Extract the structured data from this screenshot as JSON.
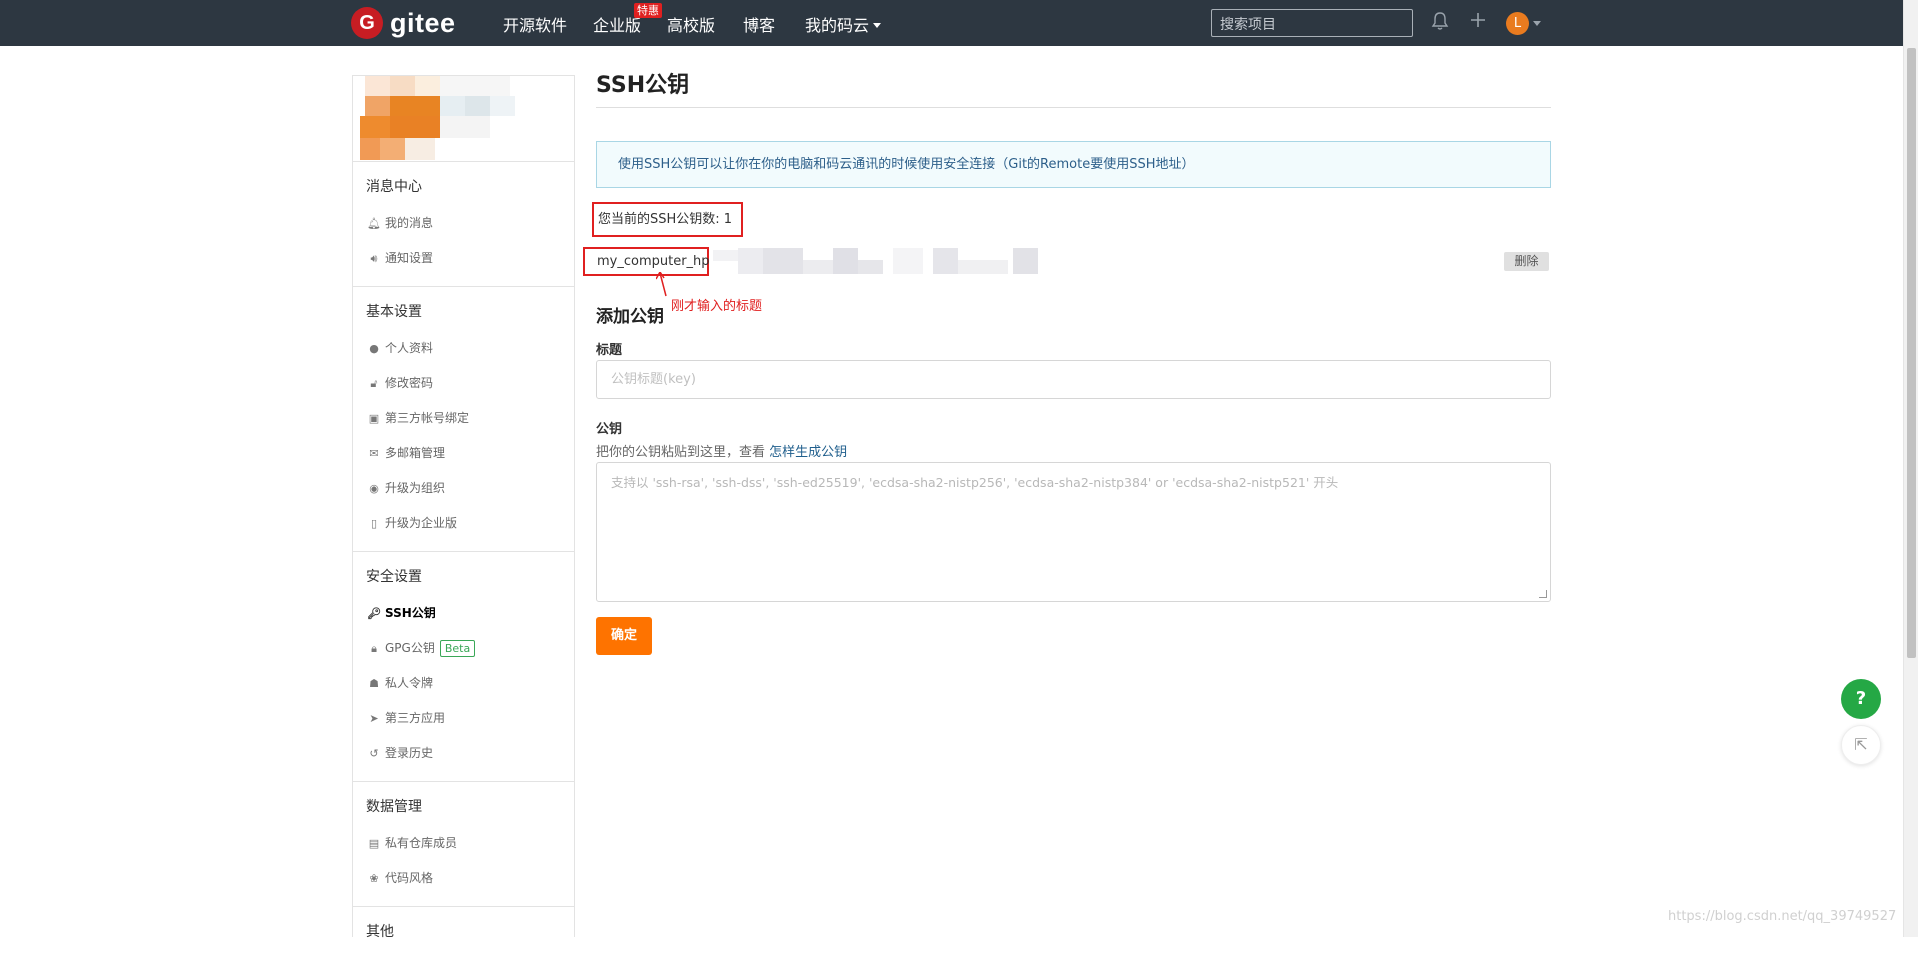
{
  "nav": {
    "logo_letter": "G",
    "logo_text": "gitee",
    "links": [
      "开源软件",
      "企业版",
      "高校版",
      "博客",
      "我的码云"
    ],
    "hot_badge": "特惠",
    "search_placeholder": "搜索项目",
    "avatar_letter": "L"
  },
  "sidebar": {
    "sections": [
      {
        "title": "消息中心",
        "items": [
          {
            "label": "我的消息",
            "icon": "bell-icon"
          },
          {
            "label": "通知设置",
            "icon": "speaker-icon"
          }
        ]
      },
      {
        "title": "基本设置",
        "items": [
          {
            "label": "个人资料",
            "icon": "user-icon"
          },
          {
            "label": "修改密码",
            "icon": "unlock-icon"
          },
          {
            "label": "第三方帐号绑定",
            "icon": "id-card-icon"
          },
          {
            "label": "多邮箱管理",
            "icon": "envelope-icon"
          },
          {
            "label": "升级为组织",
            "icon": "group-icon"
          },
          {
            "label": "升级为企业版",
            "icon": "building-icon"
          }
        ]
      },
      {
        "title": "安全设置",
        "items": [
          {
            "label": "SSH公钥",
            "icon": "key-icon",
            "active": true
          },
          {
            "label": "GPG公钥",
            "icon": "lock-icon",
            "badge": "Beta"
          },
          {
            "label": "私人令牌",
            "icon": "token-icon"
          },
          {
            "label": "第三方应用",
            "icon": "rocket-icon"
          },
          {
            "label": "登录历史",
            "icon": "history-icon"
          }
        ]
      },
      {
        "title": "数据管理",
        "items": [
          {
            "label": "私有仓库成员",
            "icon": "repo-icon"
          },
          {
            "label": "代码风格",
            "icon": "palette-icon"
          }
        ]
      },
      {
        "title": "其他",
        "items": []
      }
    ]
  },
  "main": {
    "title": "SSH公钥",
    "info": "使用SSH公钥可以让你在你的电脑和码云通讯的时候使用安全连接（Git的Remote要使用SSH地址）",
    "key_count": "您当前的SSH公钥数: 1",
    "key_title": "my_computer_hp",
    "delete_label": "删除",
    "annotation": "刚才输入的标题",
    "add_title": "添加公钥",
    "field_title_label": "标题",
    "field_title_placeholder": "公钥标题(key)",
    "field_key_label": "公钥",
    "help_text": "把你的公钥粘贴到这里，查看 ",
    "help_link": "怎样生成公钥",
    "textarea_placeholder": "支持以 'ssh-rsa', 'ssh-dss', 'ssh-ed25519', 'ecdsa-sha2-nistp256', 'ecdsa-sha2-nistp384' or 'ecdsa-sha2-nistp521' 开头",
    "submit_label": "确定"
  },
  "float": {
    "help": "?",
    "share": "⇱"
  },
  "watermark": "https://blog.csdn.net/qq_39749527",
  "colors": {
    "nav_bg": "#2d3741",
    "brand": "#c71d23",
    "accent": "#fe7300",
    "annotation": "#e02020",
    "help_fab": "#25a845"
  }
}
